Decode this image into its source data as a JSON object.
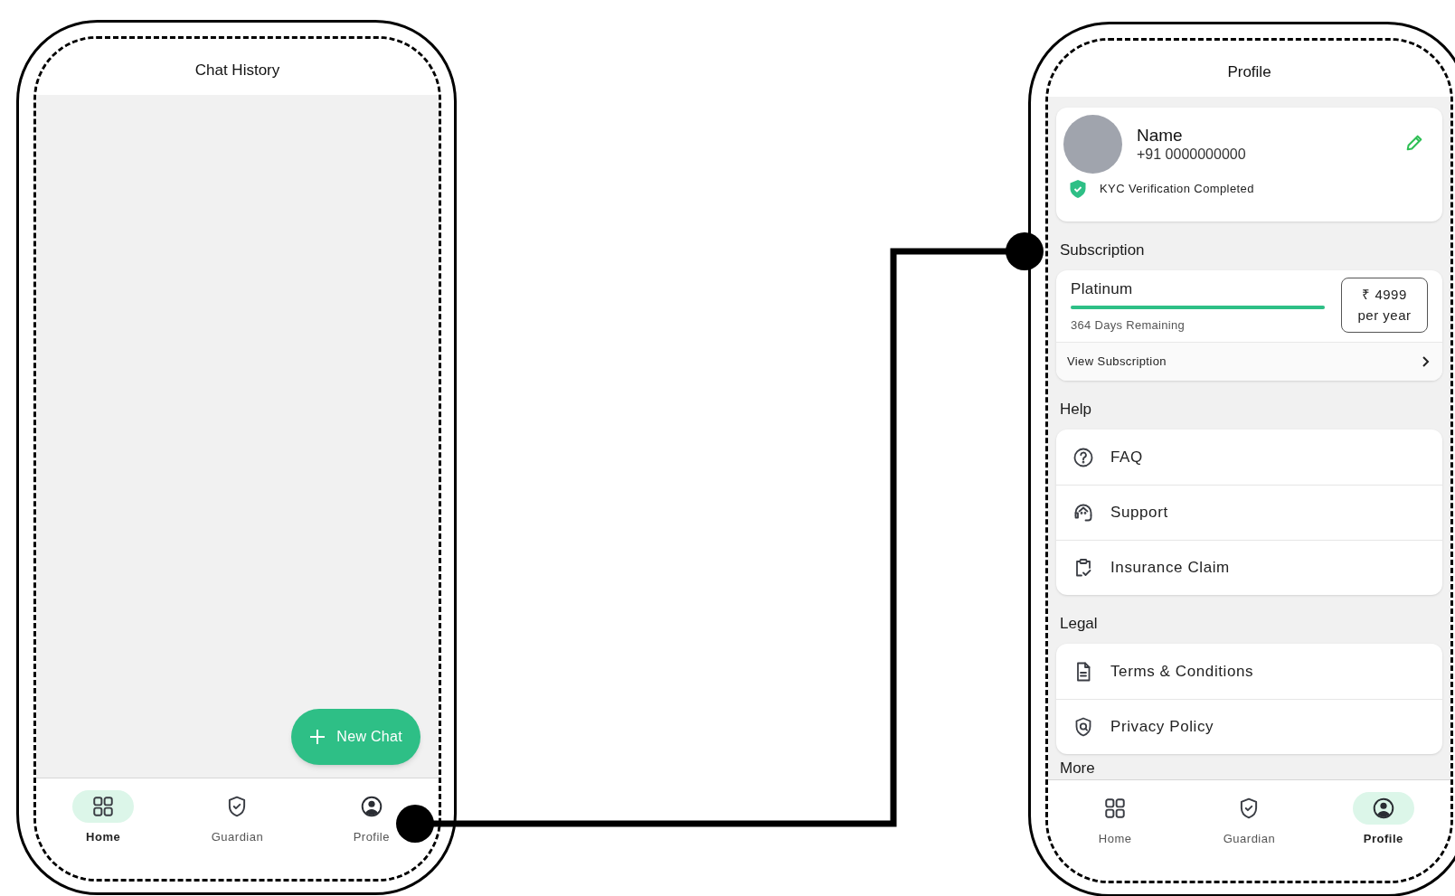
{
  "screens": [
    {
      "kind": "chat_history",
      "title": "Chat History",
      "fab": {
        "label": "New Chat"
      },
      "nav": [
        {
          "label": "Home",
          "kind": "home",
          "selected": true
        },
        {
          "label": "Guardian",
          "kind": "guardian",
          "selected": false
        },
        {
          "label": "Profile",
          "kind": "profile",
          "selected": false
        }
      ]
    },
    {
      "kind": "profile",
      "title": "Profile",
      "profile": {
        "name": "Name",
        "phone": "+91 0000000000",
        "kyc": "KYC Verification Completed"
      },
      "subscription": {
        "heading": "Subscription",
        "plan": "Platinum",
        "level": 1,
        "remaining": "364 Days Remaining",
        "price": "₹ 4999",
        "period": "per year",
        "link": "View Subscription"
      },
      "sections": [
        {
          "heading": "Help",
          "items": [
            {
              "label": "FAQ",
              "kind": "faq"
            },
            {
              "label": "Support",
              "kind": "support"
            },
            {
              "label": "Insurance Claim",
              "kind": "claim"
            }
          ]
        },
        {
          "heading": "Legal",
          "items": [
            {
              "label": "Terms & Conditions",
              "kind": "terms"
            },
            {
              "label": "Privacy Policy",
              "kind": "privacy"
            }
          ]
        },
        {
          "heading": "More"
        }
      ],
      "nav": [
        {
          "label": "Home",
          "kind": "home",
          "selected": false
        },
        {
          "label": "Guardian",
          "kind": "guardian",
          "selected": false
        },
        {
          "label": "Profile",
          "kind": "profile",
          "selected": true
        }
      ]
    }
  ]
}
